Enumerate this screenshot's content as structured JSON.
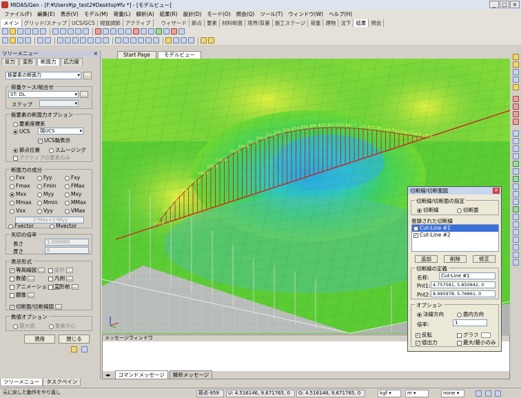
{
  "window": {
    "title": "MIDAS/Gen - [F:¥Users¥jp_test2¥Desktop¥fv *] - [モデルビュー]"
  },
  "menu": [
    "ファイル(F)",
    "編集(E)",
    "表示(V)",
    "モデル(M)",
    "荷重(L)",
    "解析(A)",
    "結果(R)",
    "設計(D)",
    "モード(O)",
    "照会(Q)",
    "ツール(T)",
    "ウィンドウ(W)",
    "ヘルプ(H)"
  ],
  "ribbon_tabs_left": [
    "メイン",
    "グリッド/スナップ",
    "UCS/GCS",
    "視覚調節",
    "アクティブ"
  ],
  "ribbon_tabs_right": [
    "ウィザード",
    "節点",
    "要素",
    "材料断面",
    "境界/質量",
    "施工ステージ",
    "荷重",
    "建物",
    "沈下",
    "結果",
    "照会"
  ],
  "tree": {
    "title": "ツリーメニュー",
    "tabs": [
      "反力",
      "変形",
      "断面力",
      "応力度"
    ],
    "dropdown": "板要素の断面力",
    "loadcase_title": "荷重ケース/組合せ",
    "loadcase_value": "ST: DL",
    "step_label": "ステップ",
    "options_title": "板要素の断面力オプション",
    "radio_elem": "要素座標系",
    "radio_ucs": "UCS",
    "ucs_value": "現UCS",
    "ucs_axis": "UCS軸表示",
    "radio_node": "節点位置",
    "radio_smooth": "スムージング",
    "active_only": "アクティブの要素のみ",
    "components_title": "断面力の成分",
    "components": [
      [
        "Fxx",
        "Fyy",
        "Fxy"
      ],
      [
        "Fmax",
        "Fmin",
        "FMax"
      ],
      [
        "Mxx",
        "Myy",
        "Mxy"
      ],
      [
        "Mmax",
        "Mmin",
        "MMax"
      ],
      [
        "Vxx",
        "Vyy",
        "VMax"
      ]
    ],
    "formula": "1*Mxx+1*Myy",
    "fvector": "Fvector",
    "mvector": "Mvector",
    "arrow_title": "矢印の倍率",
    "length_label": "長さ",
    "length_value": "1.000000",
    "thickness_label": "厚さ",
    "thickness_value": "0",
    "display_title": "表示形式",
    "display_items": [
      "等高線図",
      "変形",
      "数値",
      "凡例",
      "アニメーション",
      "変形前",
      "鏡像"
    ],
    "section_display": "切断面/切断線図",
    "numeric_title": "数値オプション",
    "numeric_max": "最大値",
    "numeric_center": "要素中心",
    "apply": "適用",
    "close": "閉じる",
    "bottom_tabs": [
      "ツリーメニュー",
      "タスクペイン"
    ]
  },
  "doc_tabs": [
    "Start Page",
    "モデルビュー"
  ],
  "message_window": {
    "title": "メッセージウィンドウ",
    "tabs": [
      "コマンドメッセージ",
      "解析メッセージ"
    ]
  },
  "dialog": {
    "title": "切断線/切断面図",
    "spec_title": "切断線/切断面の指定",
    "radio_line": "切断線",
    "radio_plane": "切断面",
    "registered": "登録された切断線",
    "items": [
      "Cut-Line #1",
      "Cut-Line #2"
    ],
    "add": "追加",
    "delete": "削除",
    "modify": "修正",
    "def_title": "切断線の定義",
    "name_label": "名称:",
    "name_value": "Cut-Line #1",
    "pnt1_label": "Pnt1:",
    "pnt1_value": "4.757581, 5.850842, 0",
    "pnt2_label": "Pnt2:",
    "pnt2_value": "8.995978, 5.76861, 0",
    "opt_title": "オプション",
    "normal_dir": "法線方向",
    "in_plane": "面内方向",
    "scale_label": "倍率:",
    "scale_value": "1",
    "invert": "反転",
    "graph": "グラフ",
    "value_out": "値出力",
    "maxmin": "最大/最小のみ"
  },
  "labels_on_model": [
    "143.4",
    "155.1",
    "163.1",
    "173.2",
    "183.3",
    "190.2",
    "200.3",
    "210.4",
    "222.5",
    "230.6",
    "241.8",
    "253.9",
    "250.0",
    "240.2",
    "225.1",
    "210.0",
    "196.3",
    "180.4",
    "130.5",
    "161.2",
    "150.1",
    "142.7",
    "125.0",
    "102.3",
    "98.1",
    "84.5",
    "62.0",
    "40.1",
    "94.8",
    "108.2"
  ],
  "status": {
    "hint": "元に戻した動作をやり直し",
    "node": "節点-959",
    "u": "U: 4.516146, 9.671765, 0",
    "g": "G: 4.516146, 9.671765, 0",
    "unit1": "kgf",
    "unit2": "m",
    "unit3": "none"
  }
}
